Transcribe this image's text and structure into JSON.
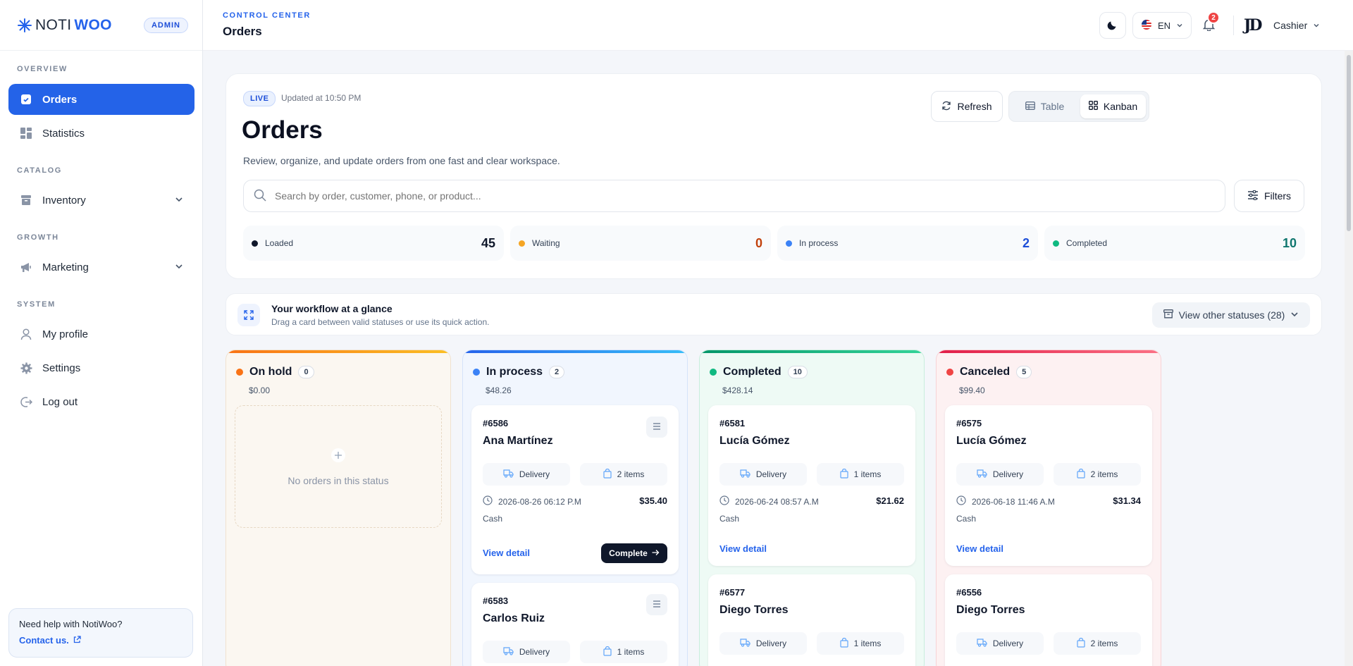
{
  "brand": {
    "logo_left": "NOTI",
    "logo_right": "WOO",
    "role": "ADMIN"
  },
  "sidebar": {
    "sections": [
      "OVERVIEW",
      "CATALOG",
      "GROWTH",
      "SYSTEM"
    ],
    "items": [
      {
        "label": "Orders",
        "icon": "clipboard-icon",
        "active": true
      },
      {
        "label": "Statistics",
        "icon": "grid-icon"
      },
      {
        "label": "Inventory",
        "icon": "archive-icon"
      },
      {
        "label": "Marketing",
        "icon": "megaphone-icon"
      },
      {
        "label": "My profile",
        "icon": "user-icon"
      },
      {
        "label": "Settings",
        "icon": "gear-icon"
      },
      {
        "label": "Log out",
        "icon": "logout-icon"
      }
    ],
    "help": {
      "title": "Need help with NotiWoo?",
      "link": "Contact us."
    }
  },
  "topbar": {
    "section": "CONTROL CENTER",
    "title": "Orders",
    "language": "EN",
    "notifications": "2",
    "user_initials": "JD",
    "user_role": "Cashier"
  },
  "panel": {
    "live": "LIVE",
    "updated": "Updated at 10:50 PM",
    "title": "Orders",
    "description": "Review, organize, and update orders from one fast and clear workspace.",
    "refresh": "Refresh",
    "view_table": "Table",
    "view_kanban": "Kanban",
    "search_placeholder": "Search by order, customer, phone, or product...",
    "filters": "Filters",
    "stats": [
      {
        "label": "Loaded",
        "value": "45",
        "color": "#0f172a"
      },
      {
        "label": "Waiting",
        "value": "0",
        "color": "#c2410c"
      },
      {
        "label": "In process",
        "value": "2",
        "color": "#1d4ed8"
      },
      {
        "label": "Completed",
        "value": "10",
        "color": "#0f766e"
      }
    ]
  },
  "workflow": {
    "title": "Your workflow at a glance",
    "subtitle": "Drag a card between valid statuses or use its quick action.",
    "other": "View other statuses (28)"
  },
  "columns": [
    {
      "title": "On hold",
      "count": "0",
      "total": "$0.00",
      "empty": "No orders in this status",
      "accent": "#f59e0b"
    },
    {
      "title": "In process",
      "count": "2",
      "total": "$48.26",
      "accent": "#3b82f6"
    },
    {
      "title": "Completed",
      "count": "10",
      "total": "$428.14",
      "accent": "#10b981"
    },
    {
      "title": "Canceled",
      "count": "5",
      "total": "$99.40",
      "accent": "#ef4444"
    }
  ],
  "cards": {
    "c6586": {
      "id": "#6586",
      "name": "Ana Martínez",
      "type": "Delivery",
      "items": "2 items",
      "date": "2026-08-26 06:12 P.M",
      "amount": "$35.40",
      "payment": "Cash",
      "detail": "View detail",
      "action": "Complete"
    },
    "c6583": {
      "id": "#6583",
      "name": "Carlos Ruiz",
      "type": "Delivery",
      "items": "1 items"
    },
    "c6581": {
      "id": "#6581",
      "name": "Lucía Gómez",
      "type": "Delivery",
      "items": "1 items",
      "date": "2026-06-24 08:57 A.M",
      "amount": "$21.62",
      "payment": "Cash",
      "detail": "View detail"
    },
    "c6577": {
      "id": "#6577",
      "name": "Diego Torres",
      "type": "Delivery",
      "items": "1 items"
    },
    "c6575": {
      "id": "#6575",
      "name": "Lucía Gómez",
      "type": "Delivery",
      "items": "2 items",
      "date": "2026-06-18 11:46 A.M",
      "amount": "$31.34",
      "payment": "Cash",
      "detail": "View detail"
    },
    "c6556": {
      "id": "#6556",
      "name": "Diego Torres",
      "type": "Delivery",
      "items": "2 items"
    }
  }
}
